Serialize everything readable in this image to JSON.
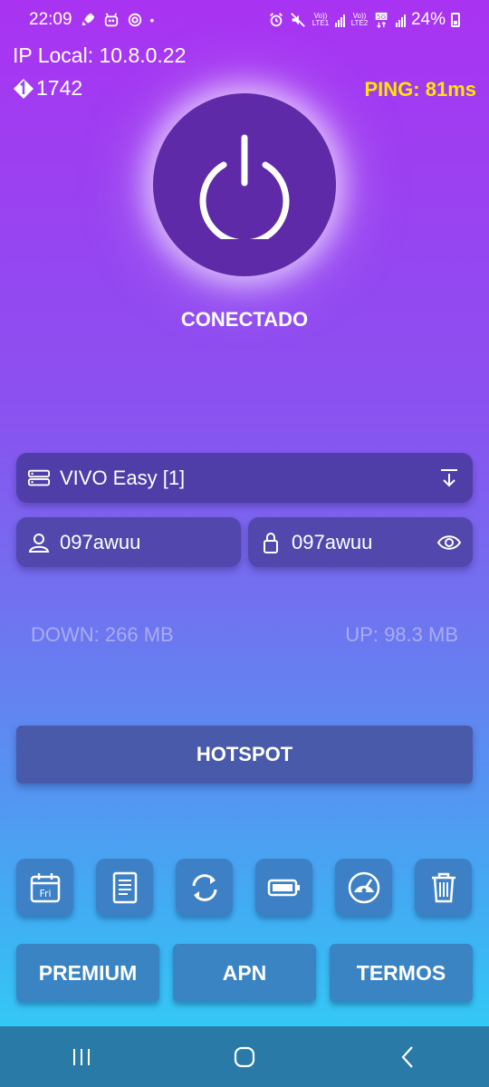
{
  "status_bar": {
    "time": "22:09",
    "battery": "24%",
    "net1_label": "Vo)) LTE1",
    "net2_label": "Vo)) LTE2"
  },
  "header": {
    "ip_local": "IP Local: 10.8.0.22",
    "counter": "1742",
    "ping": "PING: 81ms"
  },
  "connection": {
    "status": "CONECTADO"
  },
  "server": {
    "name": "VIVO Easy [1]"
  },
  "credentials": {
    "username": "097awuu",
    "password": "097awuu"
  },
  "traffic": {
    "down": "DOWN: 266 MB",
    "up": "UP: 98.3 MB"
  },
  "buttons": {
    "hotspot": "HOTSPOT",
    "premium": "PREMIUM",
    "apn": "APN",
    "termos": "TERMOS"
  },
  "tools": [
    {
      "icon": "calendar-icon",
      "label": "Fri"
    },
    {
      "icon": "document-icon"
    },
    {
      "icon": "refresh-icon"
    },
    {
      "icon": "battery-icon"
    },
    {
      "icon": "speedometer-icon"
    },
    {
      "icon": "trash-icon"
    }
  ],
  "colors": {
    "ping": "#ffe600",
    "power_button": "#5e2aa8"
  }
}
